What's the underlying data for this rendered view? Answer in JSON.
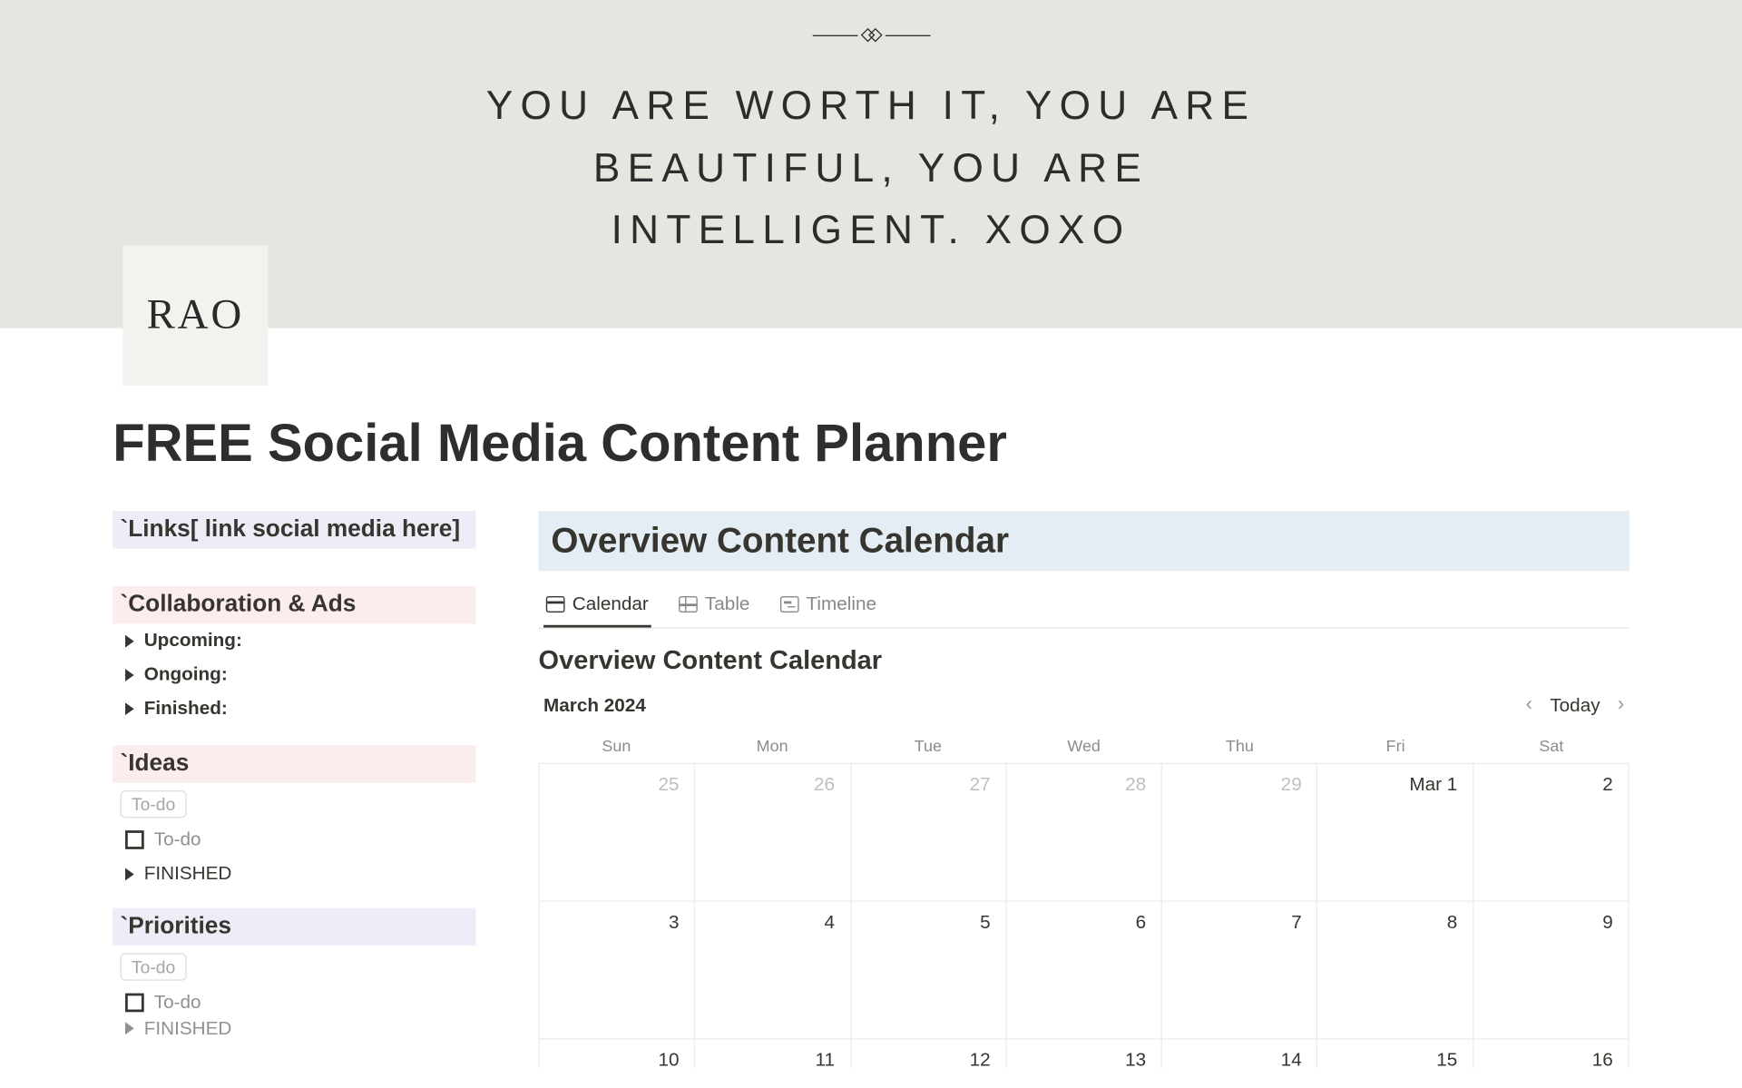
{
  "hero": {
    "quote": "YOU ARE WORTH IT, YOU ARE BEAUTIFUL, YOU ARE INTELLIGENT. XOXO",
    "logo": "RAO"
  },
  "page_title": "FREE Social Media Content Planner",
  "sidebar": {
    "links_heading": "`Links[ link social media here]",
    "collab_heading": "`Collaboration & Ads",
    "collab_items": [
      "Upcoming:",
      "Ongoing:",
      "Finished:"
    ],
    "ideas_heading": "`Ideas",
    "ideas_tag": "To-do",
    "ideas_check": "To-do",
    "ideas_toggle": "FINISHED",
    "priorities_heading": "`Priorities",
    "priorities_tag": "To-do",
    "priorities_check": "To-do",
    "priorities_toggle": "FINISHED"
  },
  "main": {
    "overview_heading": "Overview Content Calendar",
    "tabs": {
      "calendar": "Calendar",
      "table": "Table",
      "timeline": "Timeline"
    },
    "db_title": "Overview Content Calendar",
    "month": "March 2024",
    "today": "Today",
    "weekdays": [
      "Sun",
      "Mon",
      "Tue",
      "Wed",
      "Thu",
      "Fri",
      "Sat"
    ],
    "row1": [
      "25",
      "26",
      "27",
      "28",
      "29",
      "Mar 1",
      "2"
    ],
    "row1_other": [
      true,
      true,
      true,
      true,
      true,
      false,
      false
    ],
    "row2": [
      "3",
      "4",
      "5",
      "6",
      "7",
      "8",
      "9"
    ],
    "row3": [
      "10",
      "11",
      "12",
      "13",
      "14",
      "15",
      "16"
    ]
  }
}
